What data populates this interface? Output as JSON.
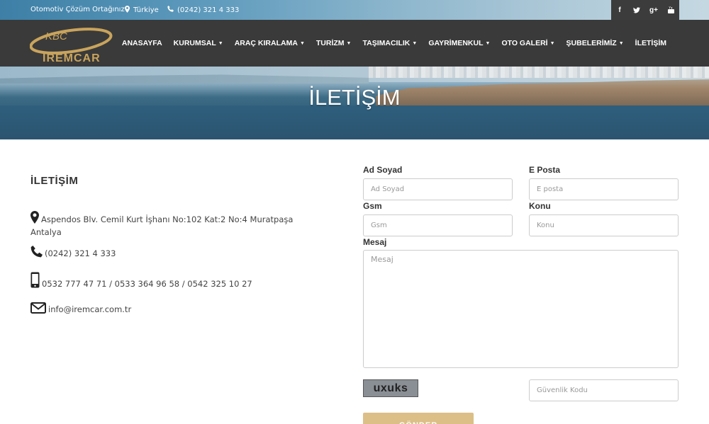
{
  "topbar": {
    "tagline": "Otomotiv Çözüm Ortağınız",
    "location": "Türkiye",
    "phone": "(0242) 321 4 333",
    "socials": [
      "f",
      "t",
      "g+",
      "yt"
    ]
  },
  "brand": {
    "logo_top": "KBC",
    "logo_bottom": "İREMCAR",
    "logo_color": "#c9a45c"
  },
  "nav": [
    {
      "label": "ANASAYFA",
      "dropdown": false
    },
    {
      "label": "KURUMSAL",
      "dropdown": true
    },
    {
      "label": "ARAÇ KIRALAMA",
      "dropdown": true
    },
    {
      "label": "TURİZM",
      "dropdown": true
    },
    {
      "label": "TAŞIMACILIK",
      "dropdown": true
    },
    {
      "label": "GAYRİMENKUL",
      "dropdown": true
    },
    {
      "label": "OTO GALERİ",
      "dropdown": true
    },
    {
      "label": "ŞUBELERİMİZ",
      "dropdown": true
    },
    {
      "label": "İLETİŞİM",
      "dropdown": false
    }
  ],
  "hero": {
    "title": "İLETİŞİM"
  },
  "contact": {
    "heading": "İLETİŞİM",
    "address_line1": "Aspendos Blv. Cemil Kurt İşhanı No:102 Kat:2 No:4 Muratpaşa",
    "address_line2": "Antalya",
    "phone": "(0242) 321 4 333",
    "mobiles": "0532 777 47 71 / 0533 364 96 58 / 0542 325 10 27",
    "email": "info@iremcar.com.tr"
  },
  "form": {
    "name_label": "Ad Soyad",
    "name_placeholder": "Ad Soyad",
    "email_label": "E Posta",
    "email_placeholder": "E posta",
    "gsm_label": "Gsm",
    "gsm_placeholder": "Gsm",
    "subject_label": "Konu",
    "subject_placeholder": "Konu",
    "message_label": "Mesaj",
    "message_placeholder": "Mesaj",
    "captcha_text": "uxuks",
    "security_placeholder": "Güvenlik Kodu",
    "submit_label": "GÖNDER"
  },
  "colors": {
    "header_bg": "#3a3a3a",
    "accent": "#dcbf87",
    "social_bg": "#3c3c3c"
  }
}
